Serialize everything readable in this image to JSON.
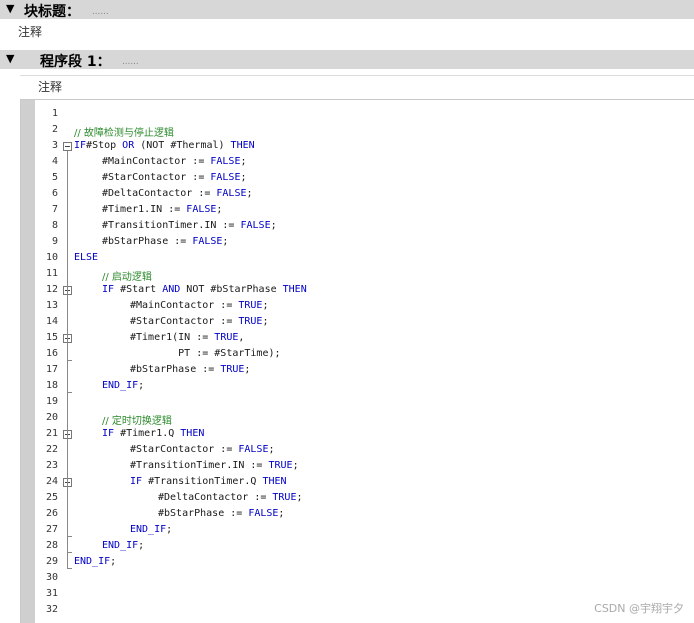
{
  "block": {
    "title": "块标题：",
    "dots": "......",
    "comment": "注释"
  },
  "network": {
    "title": "程序段 1：",
    "dots": "......",
    "comment": "注释"
  },
  "code_lines": [
    {
      "n": "1",
      "fold": false,
      "indent": 0,
      "t": []
    },
    {
      "n": "2",
      "fold": false,
      "indent": 0,
      "t": [
        [
          "cm",
          "// 故障检测与停止逻辑"
        ]
      ]
    },
    {
      "n": "3",
      "fold": true,
      "indent": 0,
      "t": [
        [
          "kw",
          "IF"
        ],
        [
          "",
          "#Stop "
        ],
        [
          "kw",
          "OR"
        ],
        [
          "",
          " (NOT #Thermal) "
        ],
        [
          "kw",
          "THEN"
        ]
      ]
    },
    {
      "n": "4",
      "fold": false,
      "indent": 1,
      "t": [
        [
          "",
          "#MainContactor := "
        ],
        [
          "kw",
          "FALSE"
        ],
        [
          "",
          ";"
        ]
      ]
    },
    {
      "n": "5",
      "fold": false,
      "indent": 1,
      "t": [
        [
          "",
          "#StarContactor := "
        ],
        [
          "kw",
          "FALSE"
        ],
        [
          "",
          ";"
        ]
      ]
    },
    {
      "n": "6",
      "fold": false,
      "indent": 1,
      "t": [
        [
          "",
          "#DeltaContactor := "
        ],
        [
          "kw",
          "FALSE"
        ],
        [
          "",
          ";"
        ]
      ]
    },
    {
      "n": "7",
      "fold": false,
      "indent": 1,
      "t": [
        [
          "",
          "#Timer1.IN := "
        ],
        [
          "kw",
          "FALSE"
        ],
        [
          "",
          ";"
        ]
      ]
    },
    {
      "n": "8",
      "fold": false,
      "indent": 1,
      "t": [
        [
          "",
          "#TransitionTimer.IN := "
        ],
        [
          "kw",
          "FALSE"
        ],
        [
          "",
          ";"
        ]
      ]
    },
    {
      "n": "9",
      "fold": false,
      "indent": 1,
      "t": [
        [
          "",
          "#bStarPhase := "
        ],
        [
          "kw",
          "FALSE"
        ],
        [
          "",
          ";"
        ]
      ]
    },
    {
      "n": "10",
      "fold": false,
      "indent": 0,
      "t": [
        [
          "kw",
          "ELSE"
        ]
      ]
    },
    {
      "n": "11",
      "fold": false,
      "indent": 1,
      "t": [
        [
          "cm",
          "// 启动逻辑"
        ]
      ]
    },
    {
      "n": "12",
      "fold": true,
      "indent": 1,
      "t": [
        [
          "kw",
          "IF"
        ],
        [
          "",
          " #Start "
        ],
        [
          "kw",
          "AND"
        ],
        [
          "",
          " NOT #bStarPhase "
        ],
        [
          "kw",
          "THEN"
        ]
      ]
    },
    {
      "n": "13",
      "fold": false,
      "indent": 2,
      "t": [
        [
          "",
          "#MainContactor := "
        ],
        [
          "kw",
          "TRUE"
        ],
        [
          "",
          ";"
        ]
      ]
    },
    {
      "n": "14",
      "fold": false,
      "indent": 2,
      "t": [
        [
          "",
          "#StarContactor := "
        ],
        [
          "kw",
          "TRUE"
        ],
        [
          "",
          ";"
        ]
      ]
    },
    {
      "n": "15",
      "fold": true,
      "indent": 2,
      "t": [
        [
          "",
          "#Timer1(IN := "
        ],
        [
          "kw",
          "TRUE"
        ],
        [
          "",
          ","
        ]
      ]
    },
    {
      "n": "16",
      "fold": false,
      "indent": 2,
      "t": [
        [
          "",
          "        PT := #StarTime);"
        ]
      ]
    },
    {
      "n": "17",
      "fold": false,
      "indent": 2,
      "t": [
        [
          "",
          "#bStarPhase := "
        ],
        [
          "kw",
          "TRUE"
        ],
        [
          "",
          ";"
        ]
      ]
    },
    {
      "n": "18",
      "fold": false,
      "indent": 1,
      "t": [
        [
          "kw",
          "END_IF"
        ],
        [
          "",
          ";"
        ]
      ]
    },
    {
      "n": "19",
      "fold": false,
      "indent": 0,
      "t": []
    },
    {
      "n": "20",
      "fold": false,
      "indent": 1,
      "t": [
        [
          "cm",
          "// 定时切换逻辑"
        ]
      ]
    },
    {
      "n": "21",
      "fold": true,
      "indent": 1,
      "t": [
        [
          "kw",
          "IF"
        ],
        [
          "",
          " #Timer1.Q "
        ],
        [
          "kw",
          "THEN"
        ]
      ]
    },
    {
      "n": "22",
      "fold": false,
      "indent": 2,
      "t": [
        [
          "",
          "#StarContactor := "
        ],
        [
          "kw",
          "FALSE"
        ],
        [
          "",
          ";"
        ]
      ]
    },
    {
      "n": "23",
      "fold": false,
      "indent": 2,
      "t": [
        [
          "",
          "#TransitionTimer.IN := "
        ],
        [
          "kw",
          "TRUE"
        ],
        [
          "",
          ";"
        ]
      ]
    },
    {
      "n": "24",
      "fold": true,
      "indent": 2,
      "t": [
        [
          "kw",
          "IF"
        ],
        [
          "",
          " #TransitionTimer.Q "
        ],
        [
          "kw",
          "THEN"
        ]
      ]
    },
    {
      "n": "25",
      "fold": false,
      "indent": 3,
      "t": [
        [
          "",
          "#DeltaContactor := "
        ],
        [
          "kw",
          "TRUE"
        ],
        [
          "",
          ";"
        ]
      ]
    },
    {
      "n": "26",
      "fold": false,
      "indent": 3,
      "t": [
        [
          "",
          "#bStarPhase := "
        ],
        [
          "kw",
          "FALSE"
        ],
        [
          "",
          ";"
        ]
      ]
    },
    {
      "n": "27",
      "fold": false,
      "indent": 2,
      "t": [
        [
          "kw",
          "END_IF"
        ],
        [
          "",
          ";"
        ]
      ]
    },
    {
      "n": "28",
      "fold": false,
      "indent": 1,
      "t": [
        [
          "kw",
          "END_IF"
        ],
        [
          "",
          ";"
        ]
      ]
    },
    {
      "n": "29",
      "fold": false,
      "indent": 0,
      "t": [
        [
          "kw",
          "END_IF"
        ],
        [
          "",
          ";"
        ]
      ]
    },
    {
      "n": "30",
      "fold": false,
      "indent": 0,
      "t": []
    },
    {
      "n": "31",
      "fold": false,
      "indent": 0,
      "t": []
    },
    {
      "n": "32",
      "fold": false,
      "indent": 0,
      "t": []
    }
  ],
  "watermark": "CSDN @宇翔宇夕",
  "colors": {
    "keyword": "#0000c8",
    "comment": "#2b8a2b",
    "header_bg": "#d7d7d7"
  }
}
